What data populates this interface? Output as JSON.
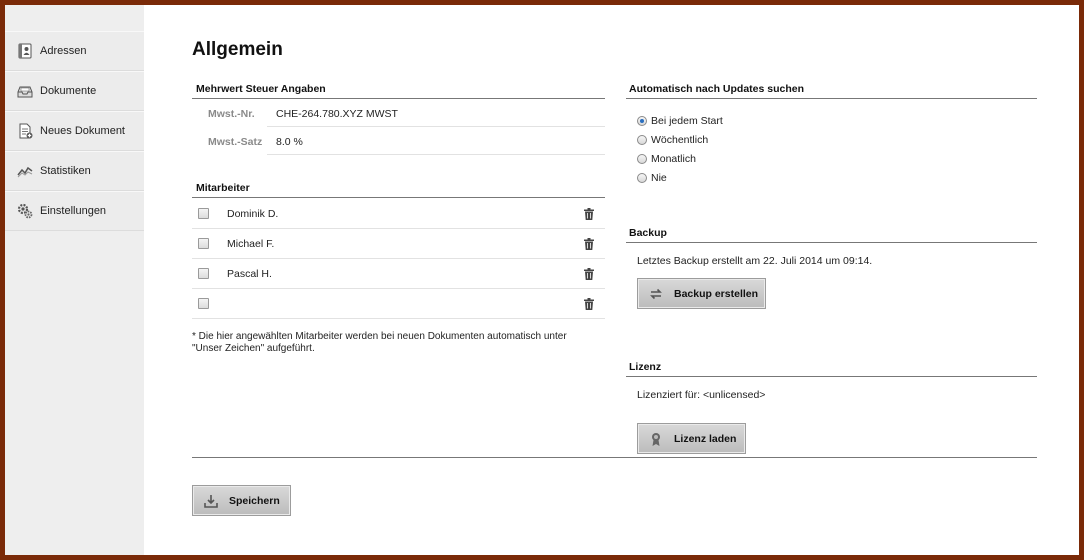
{
  "sidebar": {
    "items": [
      {
        "label": "Adressen",
        "icon": "address-book-icon"
      },
      {
        "label": "Dokumente",
        "icon": "inbox-tray-icon"
      },
      {
        "label": "Neues Dokument",
        "icon": "new-document-icon"
      },
      {
        "label": "Statistiken",
        "icon": "statistics-chart-icon"
      },
      {
        "label": "Einstellungen",
        "icon": "gears-icon"
      }
    ]
  },
  "main": {
    "title": "Allgemein",
    "vat": {
      "section_title": "Mehrwert Steuer Angaben",
      "number_label": "Mwst.-Nr.",
      "number_value": "CHE-264.780.XYZ MWST",
      "rate_label": "Mwst.-Satz",
      "rate_value": "8.0 %"
    },
    "employees": {
      "section_title": "Mitarbeiter",
      "rows": [
        {
          "name": "Dominik D.",
          "checked": false
        },
        {
          "name": "Michael F.",
          "checked": false
        },
        {
          "name": "Pascal H.",
          "checked": false
        },
        {
          "name": "",
          "checked": false
        }
      ],
      "note": "* Die hier angewählten Mitarbeiter werden bei neuen Dokumenten automatisch unter \"Unser Zeichen\" aufgeführt."
    },
    "updates": {
      "section_title": "Automatisch nach Updates suchen",
      "options": [
        "Bei jedem Start",
        "Wöchentlich",
        "Monatlich",
        "Nie"
      ],
      "selected": "Bei jedem Start"
    },
    "backup": {
      "section_title": "Backup",
      "status": "Letztes Backup erstellt am 22. Juli 2014 um 09:14.",
      "button_label": "Backup erstellen"
    },
    "license": {
      "section_title": "Lizenz",
      "status": "Lizenziert für: <unlicensed>",
      "button_label": "Lizenz laden"
    },
    "save_label": "Speichern"
  },
  "colors": {
    "frame": "#7a2a08",
    "sidebar": "#eeeeee",
    "radio_selected": "#2a6fc0"
  }
}
